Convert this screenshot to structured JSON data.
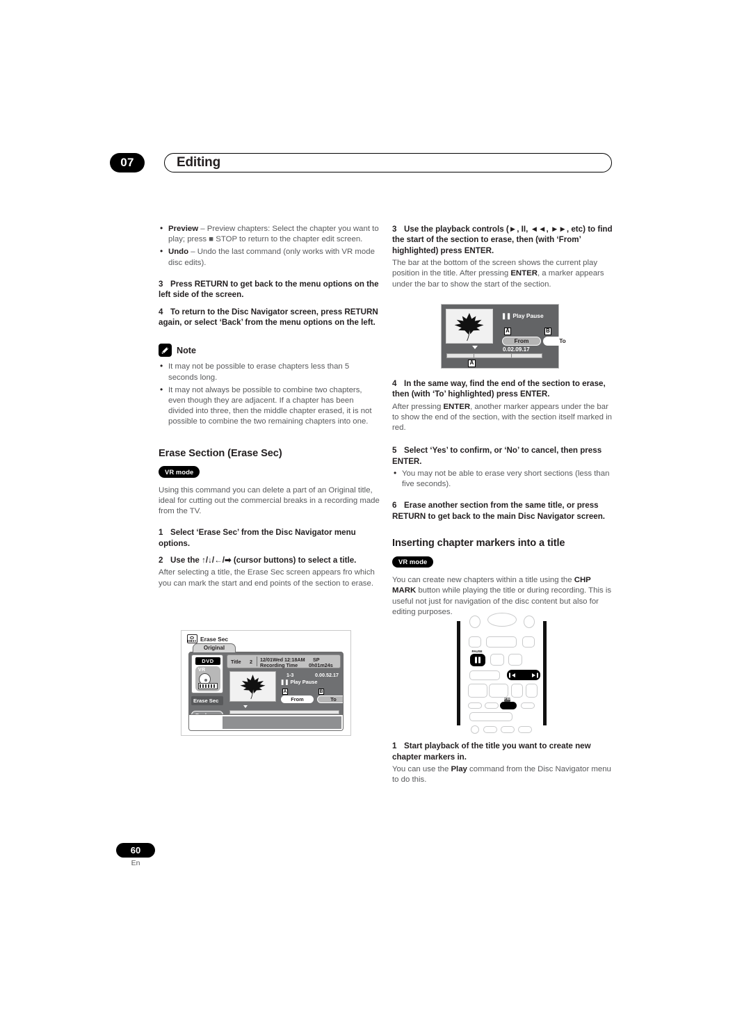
{
  "header": {
    "chapter_number": "07",
    "chapter_title": "Editing"
  },
  "footer": {
    "page_number": "60",
    "language": "En"
  },
  "left_column": {
    "bullets_top": [
      {
        "term": "Preview",
        "text": " – Preview chapters: Select the chapter you want to play; press ■ STOP to return to the chapter edit screen."
      },
      {
        "term": "Undo",
        "text": " – Undo the last command (only works with VR mode disc edits)."
      }
    ],
    "step3": {
      "num": "3",
      "text": "Press RETURN to get back to the menu options on the left side of the screen."
    },
    "step4": {
      "num": "4",
      "text": "To return to the Disc Navigator screen, press RETURN again, or select ‘Back’ from the menu options on the left."
    },
    "note": {
      "label": "Note",
      "icon": "pencil-icon",
      "items": [
        "It may not be possible to erase chapters less than 5 seconds long.",
        "It may not always be possible to combine two chapters, even though they are adjacent. If a chapter has been divided into three, then the middle chapter erased, it is not possible to combine the two remaining chapters into one."
      ]
    },
    "erase_section": {
      "heading": "Erase Section (Erase Sec)",
      "badge": "VR mode",
      "intro": "Using this command you can delete a part of an Original title, ideal for cutting out the commercial breaks in a recording made from the TV.",
      "step1": {
        "num": "1",
        "text": "Select ‘Erase Sec’ from the Disc Navigator menu options."
      },
      "step2": {
        "num": "2",
        "text": "Use the ↑/↓/←/➡ (cursor buttons) to select a title."
      },
      "step2_body": "After selecting a title, the Erase Sec screen appears fro which you can mark the start and end points of the section to erase."
    }
  },
  "osd_erase_sec": {
    "window_title": "Erase Sec",
    "window_icon": "disc-film-icon",
    "tab_label": "Original",
    "disc_badge": "DVD",
    "disc_mode": "VR",
    "menu_items": [
      {
        "label": "Erase Sec",
        "selected": true
      },
      {
        "label": "Back",
        "selected": false
      }
    ],
    "info": {
      "title_label": "Title",
      "title_number": "2",
      "date": "12/01Wed 12:18AM",
      "recording_time_label": "Recording Time",
      "speed": "SP",
      "duration": "0h01m24s"
    },
    "chapter": "1-3",
    "timecode": "0.00.52.17",
    "play_state": "Play Pause",
    "marker_a_label": "A",
    "marker_b_label": "B",
    "from_button": "From",
    "to_button": "To"
  },
  "right_column": {
    "step3": {
      "num": "3",
      "text": "Use the playback controls (►, II, ◄◄, ►►, etc) to find the start of the section to erase, then (with ‘From’ highlighted) press ENTER.",
      "body_1": "The bar at the bottom of the screen shows the current play position in the title. After pressing ",
      "body_bold": "ENTER",
      "body_2": ", a marker appears under the bar to show the start of the section."
    },
    "step4": {
      "num": "4",
      "text": "In the same way, find the end of the section to erase, then (with ‘To’ highlighted) press ENTER.",
      "body_1": "After pressing ",
      "body_bold": "ENTER",
      "body_2": ", another marker appears under the bar to show the end of the section, with the section itself marked in red."
    },
    "step5": {
      "num": "5",
      "text": "Select ‘Yes’ to confirm, or ‘No’ to cancel, then press ENTER.",
      "bullet": "You may not be able to erase very short sections (less than five seconds)."
    },
    "step6": {
      "num": "6",
      "text": "Erase another section from the same title, or press RETURN to get back to the main Disc Navigator screen."
    },
    "inserting_chapter": {
      "heading": "Inserting chapter markers into a title",
      "badge": "VR mode",
      "intro_1": "You can create new chapters within a title using the ",
      "intro_bold": "CHP MARK",
      "intro_2": " button while playing the title or during recording. This is useful not just for navigation of the disc content but also for editing purposes.",
      "step1": {
        "num": "1",
        "text": "Start playback of the title you want to create new chapter markers in.",
        "body_1": "You can use the ",
        "body_bold": "Play",
        "body_2": " command from the Disc Navigator menu to do this."
      }
    }
  },
  "osd_play_pause": {
    "play_state": "Play Pause",
    "marker_a_label": "A",
    "marker_b_label": "B",
    "from_button": "From",
    "to_button": "To",
    "timecode": "0.02.09.17",
    "bar_marker_label": "A"
  },
  "remote": {
    "pause_label": "PAUSE",
    "chp_mark_label": "CHP MARK",
    "scan_icon": "scan-reverse-forward-icon"
  }
}
